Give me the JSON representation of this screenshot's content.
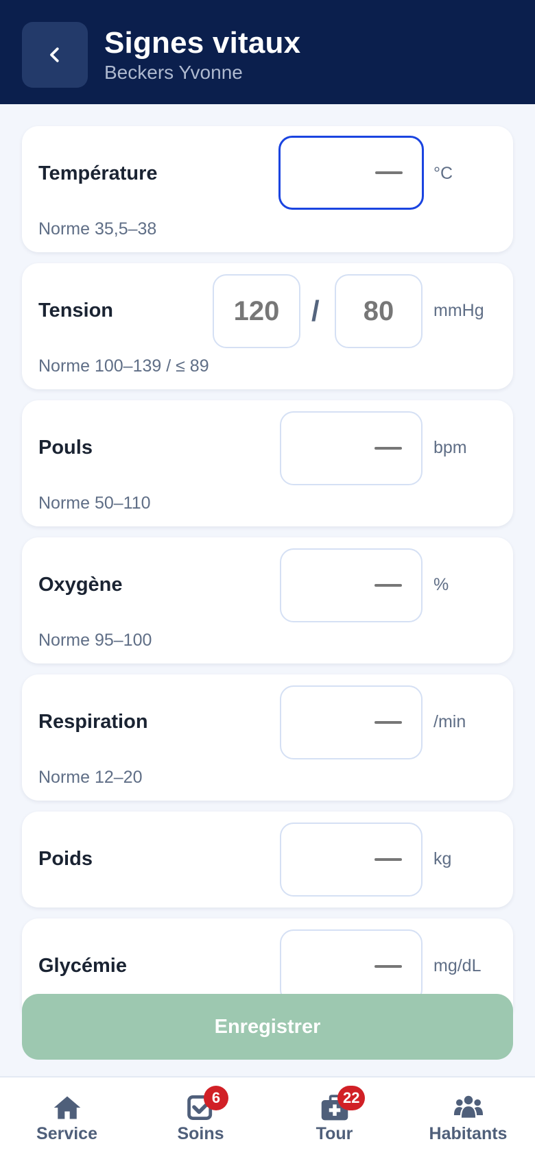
{
  "header": {
    "title": "Signes vitaux",
    "subtitle": "Beckers Yvonne",
    "back_icon": "chevron-left-icon"
  },
  "vitals": [
    {
      "label": "Température",
      "value": "",
      "unit": "°C",
      "norm": "Norme 35,5–38",
      "focused": true
    },
    {
      "label": "Tension",
      "systolic": "120",
      "separator": "/",
      "diastolic": "80",
      "unit": "mmHg",
      "norm": "Norme 100–139 / ≤ 89"
    },
    {
      "label": "Pouls",
      "value": "",
      "unit": "bpm",
      "norm": "Norme 50–110"
    },
    {
      "label": "Oxygène",
      "value": "",
      "unit": "%",
      "norm": "Norme 95–100"
    },
    {
      "label": "Respiration",
      "value": "",
      "unit": "/min",
      "norm": "Norme 12–20"
    },
    {
      "label": "Poids",
      "value": "",
      "unit": "kg"
    },
    {
      "label": "Glycémie",
      "value": "",
      "unit": "mg/dL"
    }
  ],
  "save_button": {
    "label": "Enregistrer",
    "color": "#9dc8b0"
  },
  "bottom_nav": [
    {
      "label": "Service",
      "icon": "home-icon"
    },
    {
      "label": "Soins",
      "icon": "checkbox-icon",
      "badge": "6"
    },
    {
      "label": "Tour",
      "icon": "medical-kit-icon",
      "badge": "22"
    },
    {
      "label": "Habitants",
      "icon": "users-icon"
    }
  ],
  "colors": {
    "header_bg": "#0b1f4d",
    "focus_border": "#1a44e0",
    "badge": "#d12026"
  }
}
